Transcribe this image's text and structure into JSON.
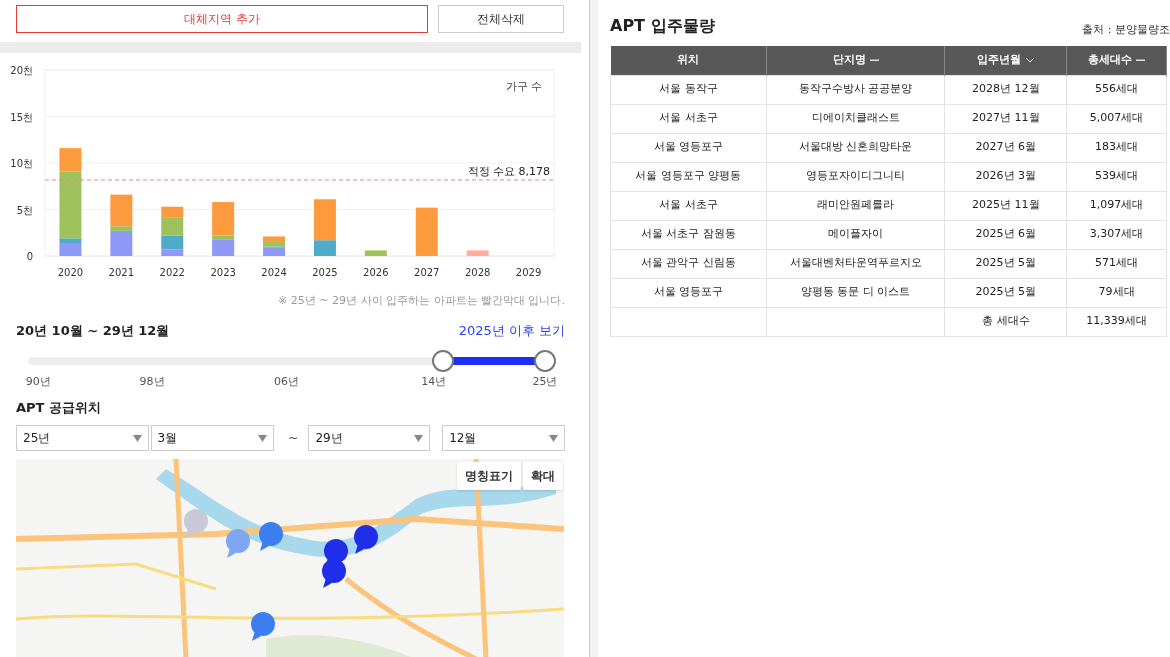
{
  "buttons": [
    {
      "label": "대체지역 추가",
      "kind": "primary"
    },
    {
      "label": "전체삭제",
      "kind": "default"
    }
  ],
  "chart": {
    "chart_data": {
      "type": "bar",
      "stacked": true,
      "ylabel": "가구 수",
      "categories": [
        "2020",
        "2021",
        "2022",
        "2023",
        "2024",
        "2025",
        "2026",
        "2027",
        "2028",
        "2029"
      ],
      "series": [
        {
          "color": "#8e98f6",
          "values": [
            1.4,
            2.6,
            0.7,
            1.8,
            0.9,
            0,
            0,
            0,
            0,
            0
          ]
        },
        {
          "color": "#4fabc9",
          "values": [
            0.5,
            0.1,
            1.5,
            0,
            0.1,
            1.7,
            0,
            0,
            0,
            0
          ]
        },
        {
          "color": "#9dc25b",
          "values": [
            7.2,
            0.5,
            1.9,
            0.4,
            0.5,
            0,
            0.6,
            0.1,
            0,
            0
          ]
        },
        {
          "color": "#fd9a3d",
          "values": [
            2.5,
            3.4,
            1.2,
            3.6,
            0.6,
            4.4,
            0,
            5.1,
            0,
            0
          ]
        },
        {
          "color": "#ffae9e",
          "values": [
            0,
            0,
            0,
            0,
            0,
            0,
            0,
            0,
            0.6,
            0
          ]
        }
      ],
      "ylim": [
        0,
        20
      ],
      "yticks": [
        {
          "value": 0,
          "label": "0"
        },
        {
          "value": 5,
          "label": "5천"
        },
        {
          "value": 10,
          "label": "10천"
        },
        {
          "value": 15,
          "label": "15천"
        },
        {
          "value": 20,
          "label": "20천"
        }
      ],
      "grid": true,
      "ref_lines": [
        {
          "axis": "y",
          "value": 8.178,
          "label": "적정 수요 8,178"
        }
      ]
    },
    "note": "※ 25년 ~ 29년 사이 입주하는 아파트는 빨간막대 입니다."
  },
  "period": {
    "label": "20년 10월 ~ 29년 12월",
    "link": "2025년 이후 보기"
  },
  "slider": {
    "thumbs": [
      {
        "level": 0.803
      },
      {
        "level": 1
      }
    ],
    "ticks": [
      "90년",
      "98년",
      "06년",
      "14년",
      "25년"
    ]
  },
  "location": {
    "title": "APT 공급위치",
    "selects": [
      {
        "value": "25년"
      },
      {
        "value": "3월"
      },
      {
        "value": "29년"
      },
      {
        "value": "12월"
      }
    ],
    "separator": "~"
  },
  "map": {
    "kind": "picture",
    "buttons": [
      "명칭표기",
      "확대"
    ]
  },
  "table": {
    "title": "APT 입주물량",
    "source": "출처 : 분양물량조",
    "columns": [
      {
        "label": "위치",
        "kind": "plain"
      },
      {
        "label": "단지명",
        "kind": "sortable"
      },
      {
        "label": "입주년월",
        "kind": "sorted"
      },
      {
        "label": "총세대수",
        "kind": "sortable"
      }
    ],
    "rows": [
      [
        "서울 동작구",
        "동작구수방사 공공분양",
        "2028년 12월",
        "556세대"
      ],
      [
        "서울 서초구",
        "디에이치클래스트",
        "2027년 11월",
        "5,007세대"
      ],
      [
        "서울 영등포구",
        "서울대방 신혼희망타운",
        "2027년 6월",
        "183세대"
      ],
      [
        "서울 영등포구 양평동",
        "영등포자이디그니티",
        "2026년 3월",
        "539세대"
      ],
      [
        "서울 서초구",
        "래미안원페를라",
        "2025년 11월",
        "1,097세대"
      ],
      [
        "서울 서초구 잠원동",
        "메이플자이",
        "2025년 6월",
        "3,307세대"
      ],
      [
        "서울 관악구 신림동",
        "서울대벤처타운역푸르지오",
        "2025년 5월",
        "571세대"
      ],
      [
        "서울 영등포구",
        "양평동 동문 디 이스트",
        "2025년 5월",
        "79세대"
      ]
    ],
    "total": {
      "label": "총 세대수",
      "value": "11,339세대"
    }
  }
}
